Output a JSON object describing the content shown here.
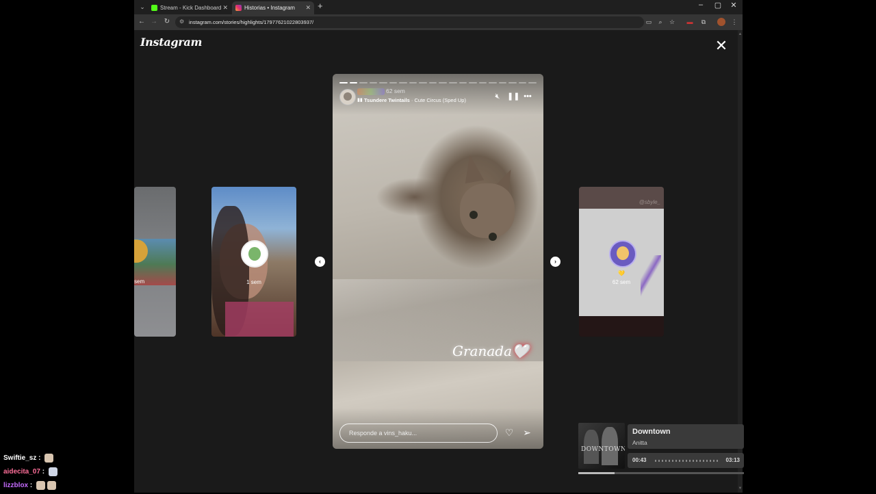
{
  "browser": {
    "tabs": [
      {
        "title": "Stream - Kick Dashboard",
        "favicon_color": "#53fc18",
        "active": false
      },
      {
        "title": "Historias • Instagram",
        "favicon_color": "#e1306c",
        "active": true
      }
    ],
    "url": "instagram.com/stories/highlights/17977621022803937/",
    "icons": [
      "back-icon",
      "forward-icon",
      "reload-icon",
      "site-info-icon",
      "install-icon",
      "zoom-icon",
      "bookmark-star-icon",
      "extension-icon",
      "puzzle-icon",
      "profile-icon",
      "kebab-menu-icon"
    ]
  },
  "instagram": {
    "logo": "Instagram",
    "close_glyph": "✕",
    "side_stories": [
      {
        "time": "sem"
      },
      {
        "time": "1 sem"
      },
      {
        "time": "62 sem",
        "emoji": "💛",
        "watermark": "@sbyle_"
      }
    ],
    "story": {
      "time": "62 sem",
      "music_title": "Tsundere Twintails",
      "music_sep": " · ",
      "music_song": "Cute Circus (Sped Up)",
      "sticker_text": "Granada",
      "sticker_heart": "🤍",
      "reply_placeholder": "Responde a vins_haku...",
      "progress_segments": 20,
      "progress_done": 2
    }
  },
  "player": {
    "song": "Downtown",
    "artist": "Anitta",
    "cover_text": "DOWNTOWN",
    "elapsed": "00:43",
    "total": "03:13",
    "progress": 0.22
  },
  "chat": [
    {
      "user": "Swiftie_sz",
      "color": "#ffffff"
    },
    {
      "user": "aidecita_07",
      "color": "#ff6f9a"
    },
    {
      "user": "lizzblox",
      "color": "#c66bff"
    }
  ]
}
